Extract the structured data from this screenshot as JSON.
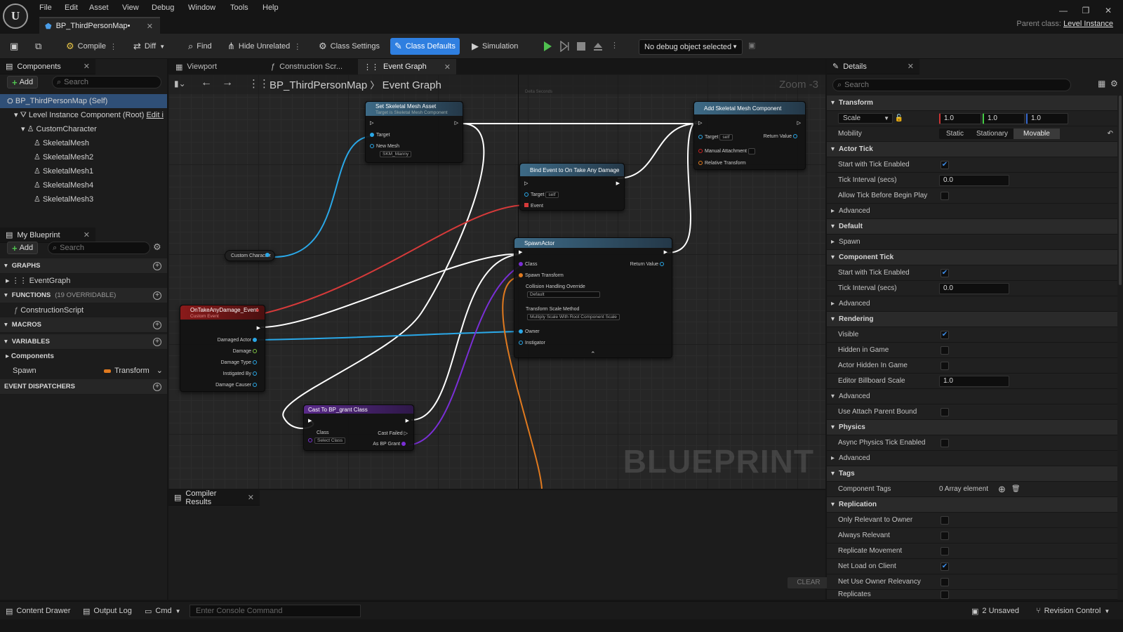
{
  "app": {
    "logo": "U",
    "doc_tab": "BP_ThirdPersonMap•",
    "parent_class_label": "Parent class:",
    "parent_class": "Level Instance"
  },
  "menu": [
    "File",
    "Edit",
    "Asset",
    "View",
    "Debug",
    "Window",
    "Tools",
    "Help"
  ],
  "toolbar": {
    "compile": "Compile",
    "diff": "Diff",
    "find": "Find",
    "hide_unrelated": "Hide Unrelated",
    "class_settings": "Class Settings",
    "class_defaults": "Class Defaults",
    "simulation": "Simulation",
    "debug_object": "No debug object selected"
  },
  "components": {
    "title": "Components",
    "add": "Add",
    "search_placeholder": "Search",
    "items": [
      {
        "label": "BP_ThirdPersonMap (Self)"
      },
      {
        "label": "Level Instance Component (Root)",
        "extra": "Edit i"
      },
      {
        "label": "CustomCharacter"
      },
      {
        "label": "SkeletalMesh"
      },
      {
        "label": "SkeletalMesh2"
      },
      {
        "label": "SkeletalMesh1"
      },
      {
        "label": "SkeletalMesh4"
      },
      {
        "label": "SkeletalMesh3"
      }
    ]
  },
  "my_blueprint": {
    "title": "My Blueprint",
    "add": "Add",
    "search_placeholder": "Search",
    "graphs": "GRAPHS",
    "event_graph": "EventGraph",
    "functions": "FUNCTIONS",
    "functions_count": "(19 OVERRIDABLE)",
    "construction_script": "ConstructionScript",
    "macros": "MACROS",
    "variables": "VARIABLES",
    "components_group": "Components",
    "var_name": "Spawn",
    "var_type": "Transform",
    "event_dispatchers": "EVENT DISPATCHERS"
  },
  "graph_tabs": [
    "Viewport",
    "Construction Scr...",
    "Event Graph"
  ],
  "graph": {
    "crumb_root": "BP_ThirdPersonMap",
    "crumb_leaf": "Event Graph",
    "zoom": "Zoom -3",
    "watermark": "BLUEPRINT",
    "delta": "Delta Seconds"
  },
  "nodes": {
    "set_mesh": {
      "title": "Set Skeletal Mesh Asset",
      "sub": "Target is Skeletal Mesh Component",
      "target": "Target",
      "new_mesh": "New Mesh",
      "mesh_val": "SKM_Manny"
    },
    "add_comp": {
      "title": "Add Skeletal Mesh Component",
      "target": "Target",
      "self": "self",
      "return": "Return Value",
      "manual": "Manual Attachment",
      "relative": "Relative Transform"
    },
    "bind": {
      "title": "Bind Event to On Take Any Damage",
      "target": "Target",
      "self": "self",
      "event": "Event"
    },
    "spawn": {
      "title": "SpawnActor",
      "class": "Class",
      "return": "Return Value",
      "transform": "Spawn Transform",
      "collision": "Collision Handling Override",
      "collision_val": "Default",
      "scale": "Transform Scale Method",
      "scale_val": "Multiply Scale With Root Component Scale",
      "owner": "Owner",
      "instigator": "Instigator"
    },
    "custom_char": {
      "label": "Custom Character"
    },
    "damage_event": {
      "title": "OnTakeAnyDamage_Event",
      "sub": "Custom Event",
      "pins": [
        "Damaged Actor",
        "Damage",
        "Damage Type",
        "Instigated By",
        "Damage Causer"
      ]
    },
    "cast": {
      "title": "Cast To BP_grant Class",
      "class": "Class",
      "class_val": "Select Class",
      "failed": "Cast Failed",
      "as": "As BP Grant"
    }
  },
  "details": {
    "title": "Details",
    "search_placeholder": "Search",
    "transform": "Transform",
    "scale": "Scale",
    "sx": "1.0",
    "sy": "1.0",
    "sz": "1.0",
    "mobility": "Mobility",
    "mob_static": "Static",
    "mob_stationary": "Stationary",
    "mob_movable": "Movable",
    "actor_tick": "Actor Tick",
    "start_tick": "Start with Tick Enabled",
    "tick_interval": "Tick Interval (secs)",
    "tick_val": "0.0",
    "allow_tick": "Allow Tick Before Begin Play",
    "advanced": "Advanced",
    "default": "Default",
    "spawn": "Spawn",
    "component_tick": "Component Tick",
    "start_tick2": "Start with Tick Enabled",
    "tick_interval2": "Tick Interval (secs)",
    "tick_val2": "0.0",
    "rendering": "Rendering",
    "visible": "Visible",
    "hidden_game": "Hidden in Game",
    "actor_hidden": "Actor Hidden In Game",
    "billboard": "Editor Billboard Scale",
    "billboard_val": "1.0",
    "use_attach": "Use Attach Parent Bound",
    "physics": "Physics",
    "async": "Async Physics Tick Enabled",
    "tags": "Tags",
    "comp_tags": "Component Tags",
    "array": "0 Array element",
    "replication": "Replication",
    "only_rel": "Only Relevant to Owner",
    "always_rel": "Always Relevant",
    "rep_move": "Replicate Movement",
    "net_load": "Net Load on Client",
    "net_owner": "Net Use Owner Relevancy",
    "replicates": "Replicates"
  },
  "compiler": {
    "title": "Compiler Results",
    "clear": "CLEAR"
  },
  "status": {
    "content_drawer": "Content Drawer",
    "output_log": "Output Log",
    "cmd": "Cmd",
    "console_placeholder": "Enter Console Command",
    "unsaved": "2 Unsaved",
    "revision": "Revision Control"
  },
  "colors": {
    "accent": "#2f7fe0",
    "exec": "#ffffff",
    "object_pin": "#2aa8e8",
    "event_red": "#d63a3a",
    "class_purple": "#7a2fd6",
    "transform_orange": "#e07a1f"
  }
}
